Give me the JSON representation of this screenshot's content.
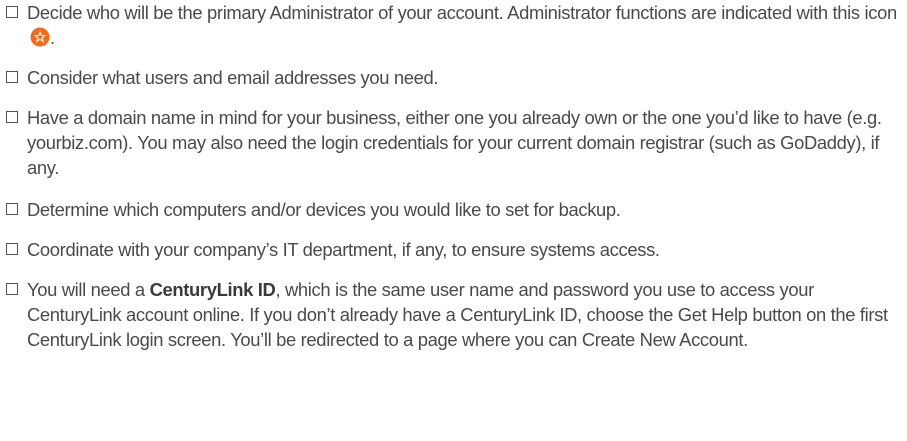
{
  "checklist": {
    "items": [
      {
        "text_before": "Decide who will be the primary Administrator of your account. Administrator functions are indicated with this icon",
        "text_after": "."
      },
      {
        "text": "Consider what users and email addresses you need."
      },
      {
        "text": "Have a domain name in mind for your business, either one you already own or the one you’d like to have (e.g. yourbiz.com). You may also need the login credentials for your current domain registrar (such as GoDaddy), if any."
      },
      {
        "text": "Determine which computers and/or devices you would like to set for backup."
      },
      {
        "text": "Coordinate with your company’s IT department, if any, to ensure systems access."
      },
      {
        "text_before": "You will need a",
        "bold": "CenturyLink ID",
        "text_after": ", which is the same user name and password you use to access your CenturyLink account online. If you don’t already have a CenturyLink ID, choose the Get Help button on the first CenturyLink login screen. You’ll be redirected to a page where you can Create New Account."
      }
    ],
    "admin_icon": {
      "name": "admin-star-icon",
      "color": "#f26b1d",
      "star_color": "#ffffff"
    }
  }
}
